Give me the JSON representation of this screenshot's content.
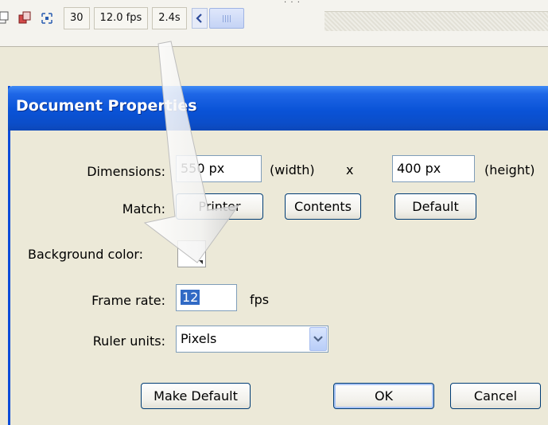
{
  "timeline": {
    "frame": "30",
    "fps": "12.0 fps",
    "time": "2.4s",
    "icons": [
      "onion-skin-icon",
      "onion-outline-icon",
      "edit-multiple-frames-icon"
    ]
  },
  "dialog": {
    "title": "Document Properties",
    "dimensions": {
      "label": "Dimensions:",
      "width": "550 px",
      "width_caption": "(width)",
      "by": "x",
      "height": "400 px",
      "height_caption": "(height)"
    },
    "match": {
      "label": "Match:",
      "printer": "Printer",
      "contents": "Contents",
      "default": "Default"
    },
    "background": {
      "label": "Background color:",
      "color": "#ffffff"
    },
    "frame_rate": {
      "label": "Frame rate:",
      "value": "12",
      "unit": "fps"
    },
    "ruler_units": {
      "label": "Ruler units:",
      "selected": "Pixels"
    },
    "buttons": {
      "make_default": "Make Default",
      "ok": "OK",
      "cancel": "Cancel"
    }
  },
  "colors": {
    "titlebar": "#0a53d7",
    "dialog_bg": "#ece9d8",
    "selection": "#316ac5"
  }
}
